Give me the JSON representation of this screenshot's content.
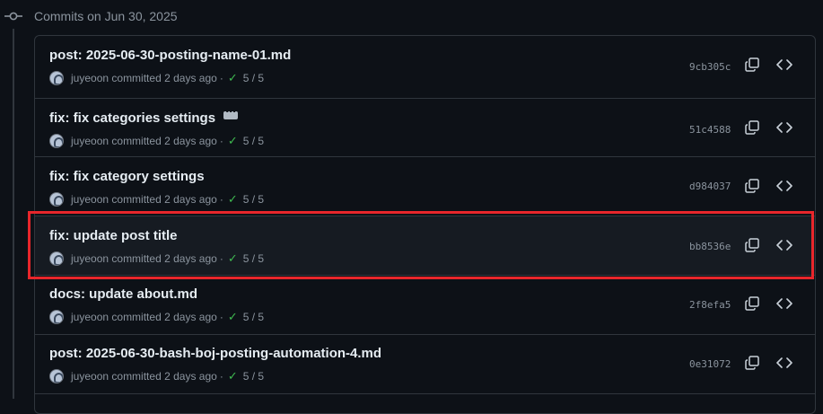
{
  "header": {
    "title": "Commits on Jun 30, 2025"
  },
  "colors": {
    "highlight": "#e8262b",
    "check": "#3fb950",
    "background": "#0d1117"
  },
  "commits": [
    {
      "title": "post: 2025-06-30-posting-name-01.md",
      "author": "juyeoon",
      "action": "committed",
      "time": "2 days ago",
      "checks": "5 / 5",
      "sha": "9cb305c",
      "has_more": false,
      "highlighted": false
    },
    {
      "title": "fix: fix categories settings",
      "author": "juyeoon",
      "action": "committed",
      "time": "2 days ago",
      "checks": "5 / 5",
      "sha": "51c4588",
      "has_more": true,
      "highlighted": false
    },
    {
      "title": "fix: fix category settings",
      "author": "juyeoon",
      "action": "committed",
      "time": "2 days ago",
      "checks": "5 / 5",
      "sha": "d984037",
      "has_more": false,
      "highlighted": false
    },
    {
      "title": "fix: update post title",
      "author": "juyeoon",
      "action": "committed",
      "time": "2 days ago",
      "checks": "5 / 5",
      "sha": "bb8536e",
      "has_more": false,
      "highlighted": true
    },
    {
      "title": "docs: update about.md",
      "author": "juyeoon",
      "action": "committed",
      "time": "2 days ago",
      "checks": "5 / 5",
      "sha": "2f8efa5",
      "has_more": false,
      "highlighted": false
    },
    {
      "title": "post: 2025-06-30-bash-boj-posting-automation-4.md",
      "author": "juyeoon",
      "action": "committed",
      "time": "2 days ago",
      "checks": "5 / 5",
      "sha": "0e31072",
      "has_more": false,
      "highlighted": false
    }
  ],
  "icons": {
    "timeline": "git-commit-icon",
    "copy": "copy-icon",
    "browse": "code-icon",
    "check": "check-icon",
    "more": "ellipsis-icon"
  }
}
